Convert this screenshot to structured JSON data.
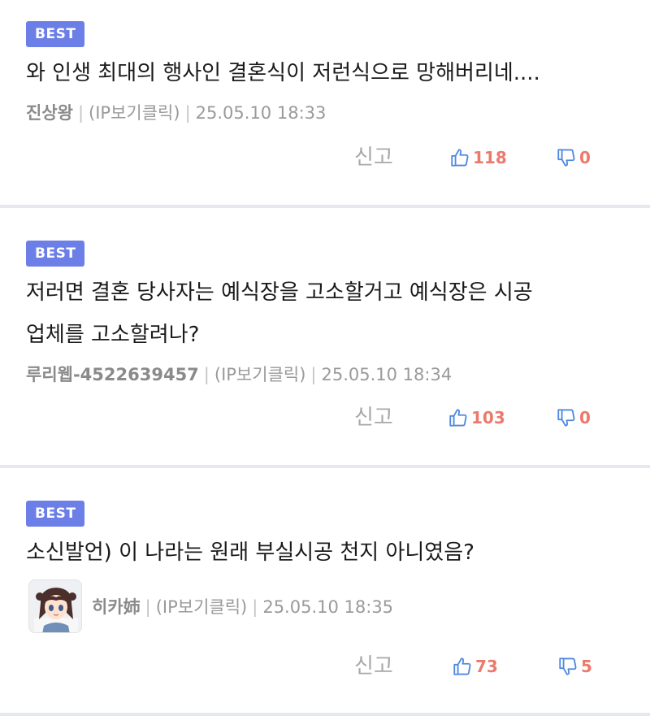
{
  "comments": [
    {
      "badge": "BEST",
      "text": "와 인생 최대의 행사인 결혼식이 저런식으로 망해버리네....",
      "author": "진상왕",
      "ip_link": "(IP보기클릭)",
      "timestamp": "25.05.10 18:33",
      "report_label": "신고",
      "upvotes": "118",
      "downvotes": "0"
    },
    {
      "badge": "BEST",
      "text_line1": "저러면 결혼 당사자는 예식장을 고소할거고 예식장은 시공",
      "text_line2": "업체를 고소할려나?",
      "author": "루리웹-4522639457",
      "ip_link": "(IP보기클릭)",
      "timestamp": "25.05.10 18:34",
      "report_label": "신고",
      "upvotes": "103",
      "downvotes": "0"
    },
    {
      "badge": "BEST",
      "text": "소신발언) 이 나라는 원래 부실시공 천지 아니였음?",
      "author": "히카姉",
      "ip_link": "(IP보기클릭)",
      "timestamp": "25.05.10 18:35",
      "report_label": "신고",
      "upvotes": "73",
      "downvotes": "5"
    }
  ],
  "colors": {
    "badge_bg": "#6c7fe6",
    "thumb_icon": "#4f88e0",
    "vote_count": "#ec7a6c",
    "separator": "#e6e8ef"
  },
  "icons": [
    "thumbs-up-icon",
    "thumbs-down-icon"
  ]
}
